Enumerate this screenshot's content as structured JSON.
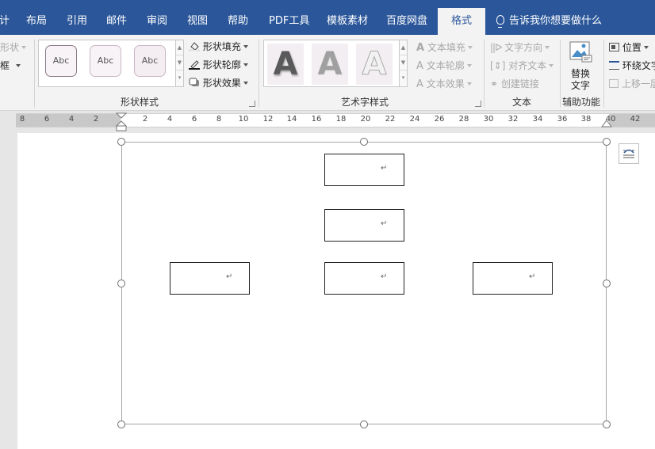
{
  "tabs": [
    {
      "label": "计",
      "active": false
    },
    {
      "label": "布局",
      "active": false
    },
    {
      "label": "引用",
      "active": false
    },
    {
      "label": "邮件",
      "active": false
    },
    {
      "label": "审阅",
      "active": false
    },
    {
      "label": "视图",
      "active": false
    },
    {
      "label": "帮助",
      "active": false
    },
    {
      "label": "PDF工具",
      "active": false
    },
    {
      "label": "模板素材",
      "active": false
    },
    {
      "label": "百度网盘",
      "active": false
    },
    {
      "label": "格式",
      "active": true
    }
  ],
  "tell_me": "告诉我你想要做什么",
  "ribbon": {
    "insert_shapes": {
      "edit_shape": "形状",
      "textbox": "框"
    },
    "shape_styles": {
      "label": "形状样式",
      "swatch_text": "Abc",
      "fill": "形状填充",
      "outline": "形状轮廓",
      "effects": "形状效果"
    },
    "wordart_styles": {
      "label": "艺术字样式",
      "letter": "A",
      "text_fill": "文本填充",
      "text_outline": "文本轮廓",
      "text_effects": "文本效果"
    },
    "text": {
      "label": "文本",
      "direction": "文字方向",
      "align": "对齐文本",
      "link": "创建链接"
    },
    "accessibility": {
      "label": "辅助功能",
      "alt_text_line1": "替换",
      "alt_text_line2": "文字"
    },
    "arrange": {
      "position": "位置",
      "wrap": "环绕文字",
      "bring_forward": "上移一层"
    }
  },
  "ruler": {
    "ticks": [
      "8",
      "6",
      "4",
      "2",
      "2",
      "4",
      "6",
      "8",
      "10",
      "12",
      "14",
      "16",
      "18",
      "20",
      "22",
      "24",
      "26",
      "28",
      "30",
      "32",
      "34",
      "36",
      "38",
      "40",
      "42"
    ]
  },
  "document": {
    "paragraph_mark": "↵",
    "boxes": [
      "top",
      "middle",
      "left",
      "center",
      "right"
    ]
  },
  "colors": {
    "tab_bar": "#2b579a",
    "ribbon_bg": "#f3f3f3",
    "accent_purple": "#8a7a86"
  }
}
